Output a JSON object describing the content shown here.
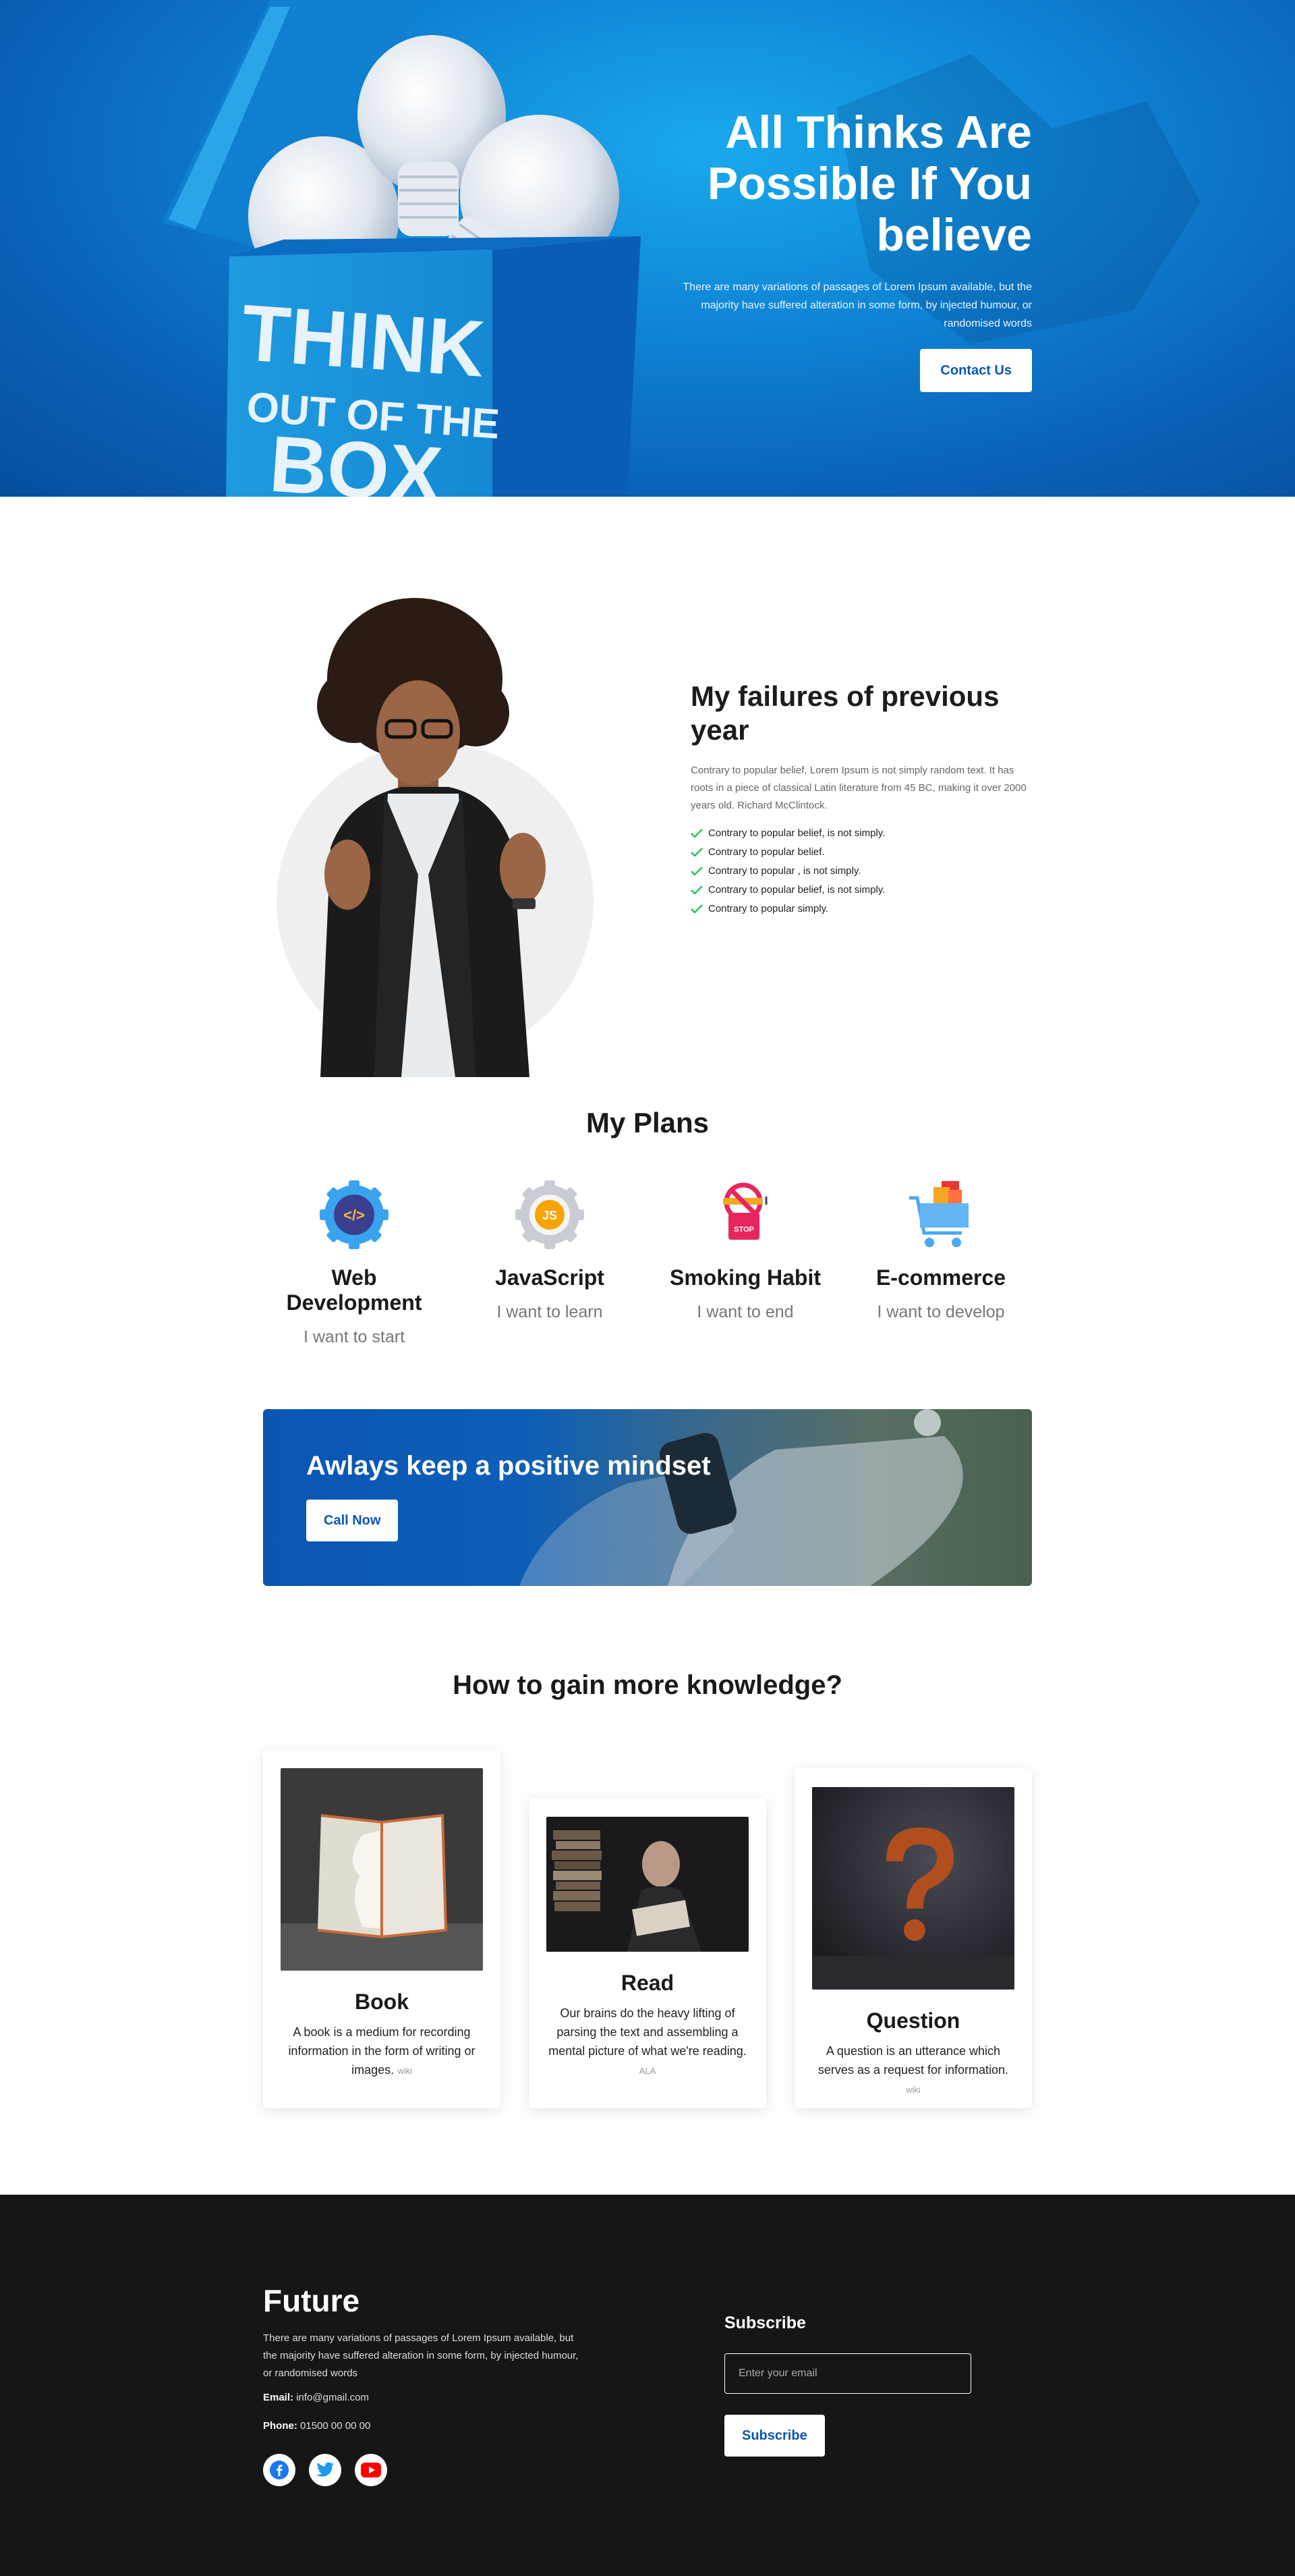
{
  "hero": {
    "title": "All Thinks Are Possible If You believe",
    "text": "There are many variations of passages of Lorem Ipsum available, but the majority have suffered alteration in some form, by injected humour, or randomised words",
    "cta": "Contact Us",
    "art_text": [
      "THINK",
      "OUT OF THE",
      "BOX"
    ]
  },
  "failures": {
    "title": "My failures of previous year",
    "text": "Contrary to popular belief, Lorem Ipsum is not simply random text. It has roots in a piece of classical Latin literature from 45 BC, making it over 2000 years old. Richard McClintock.",
    "items": [
      "Contrary to popular belief, is not simply.",
      "Contrary to popular belief.",
      "Contrary to popular , is not simply.",
      "Contrary to popular belief, is not simply.",
      "Contrary to popular simply."
    ],
    "check_color": "#22c55e"
  },
  "plans": {
    "title": "My Plans",
    "items": [
      {
        "name": "Web Development",
        "sub": "I want to start",
        "icon": "code-gear-icon",
        "badge": "</>"
      },
      {
        "name": "JavaScript",
        "sub": "I want to learn",
        "icon": "js-gear-icon",
        "badge": "JS"
      },
      {
        "name": "Smoking Habit",
        "sub": "I want to end",
        "icon": "no-smoking-icon",
        "badge": "STOP"
      },
      {
        "name": "E-commerce",
        "sub": "I want to develop",
        "icon": "shopping-cart-icon"
      }
    ]
  },
  "banner": {
    "title": "Awlays keep a positive mindset",
    "cta": "Call Now"
  },
  "knowledge": {
    "title": "How to gain more knowledge?",
    "cards": [
      {
        "title": "Book",
        "text": "A book is a medium for recording information in the form of writing or images.",
        "source": "wiki"
      },
      {
        "title": "Read",
        "text": "Our brains do the heavy lifting of parsing the text and assembling a mental picture of what we're reading.",
        "source": "ALA"
      },
      {
        "title": "Question",
        "text": "A question is an utterance which serves as a request for information.",
        "source": "wiki"
      }
    ]
  },
  "footer": {
    "brand": "Future",
    "text": "There are many variations of passages of Lorem Ipsum available, but the majority have suffered alteration in some form, by injected humour, or randomised words",
    "email_label": "Email:",
    "email": "info@gmail.com",
    "phone_label": "Phone:",
    "phone": "01500 00 00 00",
    "social": [
      "facebook-icon",
      "twitter-icon",
      "youtube-icon"
    ],
    "subscribe_title": "Subscribe",
    "subscribe_placeholder": "Enter your email",
    "subscribe_button": "Subscribe"
  },
  "colors": {
    "brand_blue": "#0a56b0",
    "footer_bg": "#161616"
  }
}
